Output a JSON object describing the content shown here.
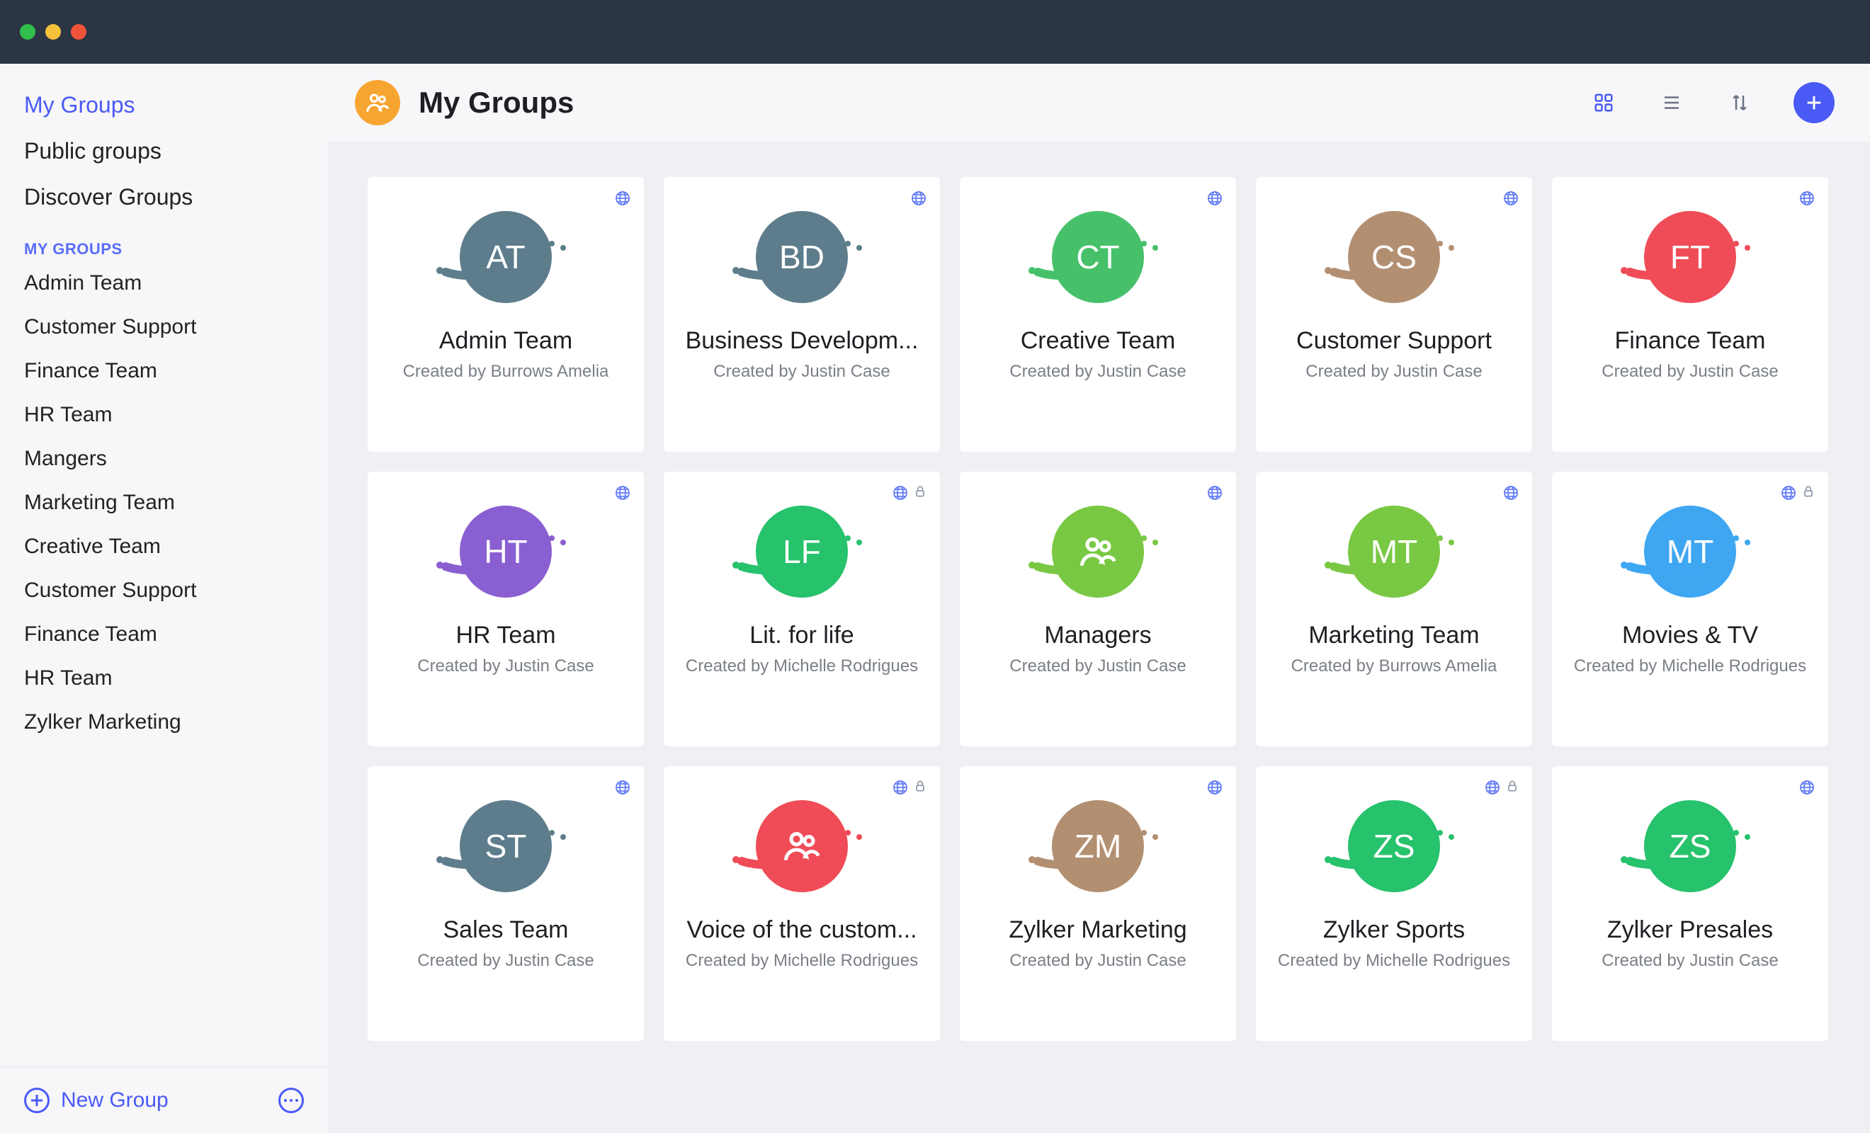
{
  "sidebar": {
    "nav": [
      {
        "key": "my",
        "label": "My Groups",
        "active": true
      },
      {
        "key": "public",
        "label": "Public groups",
        "active": false
      },
      {
        "key": "discover",
        "label": "Discover Groups",
        "active": false
      }
    ],
    "section_label": "MY GROUPS",
    "groups": [
      "Admin Team",
      "Customer Support",
      "Finance Team",
      "HR Team",
      "Mangers",
      "Marketing Team",
      "Creative Team",
      "Customer Support",
      "Finance Team",
      "HR Team",
      "Zylker Marketing"
    ],
    "new_group_label": "New Group"
  },
  "header": {
    "title": "My Groups"
  },
  "created_by_prefix": "Created by ",
  "cards": [
    {
      "initials": "AT",
      "icon": null,
      "color": "#5e7d8c",
      "title": "Admin Team",
      "creator": "Burrows Amelia",
      "badges": [
        "globe"
      ]
    },
    {
      "initials": "BD",
      "icon": null,
      "color": "#5e7d8c",
      "title": "Business Developm...",
      "creator": "Justin Case",
      "badges": [
        "globe"
      ]
    },
    {
      "initials": "CT",
      "icon": null,
      "color": "#46c16a",
      "title": "Creative Team",
      "creator": "Justin Case",
      "badges": [
        "globe"
      ]
    },
    {
      "initials": "CS",
      "icon": null,
      "color": "#b38f72",
      "title": "Customer Support",
      "creator": "Justin Case",
      "badges": [
        "globe"
      ]
    },
    {
      "initials": "FT",
      "icon": null,
      "color": "#ef4c57",
      "title": "Finance Team",
      "creator": "Justin Case",
      "badges": [
        "globe"
      ]
    },
    {
      "initials": "HT",
      "icon": null,
      "color": "#8a5fd1",
      "title": "HR Team",
      "creator": "Justin Case",
      "badges": [
        "globe"
      ]
    },
    {
      "initials": "LF",
      "icon": null,
      "color": "#27c26c",
      "title": "Lit. for life",
      "creator": "Michelle Rodrigues",
      "badges": [
        "globe",
        "lock"
      ]
    },
    {
      "initials": "",
      "icon": "people",
      "color": "#79c843",
      "title": "Managers",
      "creator": "Justin Case",
      "badges": [
        "globe"
      ]
    },
    {
      "initials": "MT",
      "icon": null,
      "color": "#79c843",
      "title": "Marketing Team",
      "creator": "Burrows Amelia",
      "badges": [
        "globe"
      ]
    },
    {
      "initials": "MT",
      "icon": null,
      "color": "#3fa6f2",
      "title": "Movies & TV",
      "creator": "Michelle Rodrigues",
      "badges": [
        "globe",
        "lock"
      ]
    },
    {
      "initials": "ST",
      "icon": null,
      "color": "#5e7d8c",
      "title": "Sales Team",
      "creator": "Justin Case",
      "badges": [
        "globe"
      ]
    },
    {
      "initials": "",
      "icon": "people",
      "color": "#ef4c57",
      "title": "Voice of the custom...",
      "creator": "Michelle Rodrigues",
      "badges": [
        "globe",
        "lock"
      ]
    },
    {
      "initials": "ZM",
      "icon": null,
      "color": "#b38f72",
      "title": "Zylker Marketing",
      "creator": "Justin Case",
      "badges": [
        "globe"
      ]
    },
    {
      "initials": "ZS",
      "icon": null,
      "color": "#27c26c",
      "title": "Zylker Sports",
      "creator": "Michelle Rodrigues",
      "badges": [
        "globe",
        "lock"
      ]
    },
    {
      "initials": "ZS",
      "icon": null,
      "color": "#27c26c",
      "title": "Zylker Presales",
      "creator": "Justin Case",
      "badges": [
        "globe"
      ]
    }
  ]
}
